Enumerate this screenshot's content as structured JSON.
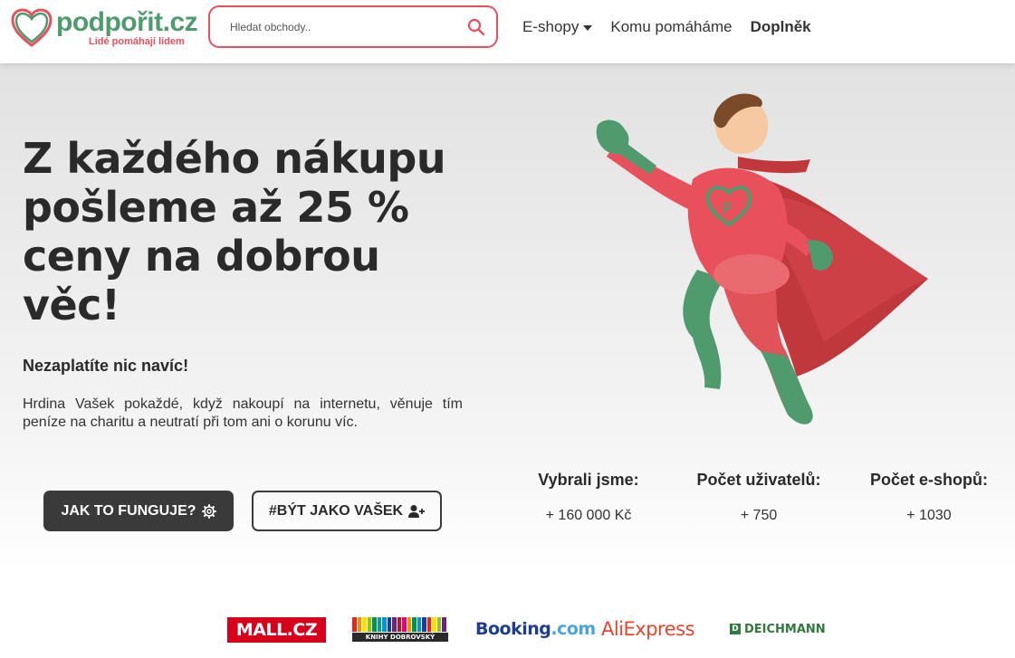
{
  "header": {
    "logo_text": "podpořit.cz",
    "logo_tagline": "Lidé pomáhají lidem",
    "search_placeholder": "Hledat obchody..",
    "nav": {
      "eshops": "E-shopy",
      "komu": "Komu pomáháme",
      "doplnek": "Doplněk"
    }
  },
  "hero": {
    "title": "Z každého nákupu pošleme až 25 % ceny na dobrou věc!",
    "subtitle": "Nezaplatíte nic navíc!",
    "description": "Hrdina Vašek pokaždé, když nakoupí na internetu, věnuje tím peníze na charitu a neutratí při tom ani o korunu víc.",
    "btn_how": "JAK TO FUNGUJE?",
    "btn_be": "#BÝT JAKO VAŠEK"
  },
  "stats": [
    {
      "label": "Vybrali jsme:",
      "value": "+ 160 000 Kč"
    },
    {
      "label": "Počet uživatelů:",
      "value": "+ 750"
    },
    {
      "label": "Počet e-shopů:",
      "value": "+ 1030"
    }
  ],
  "brands": {
    "mall": "MALL.CZ",
    "knihy": "KNIHY DOBROVSKÝ",
    "booking_main": "Booking",
    "booking_dot": ".com",
    "ali": "AliExpress",
    "deichmann": "DEICHMANN"
  },
  "colors": {
    "accent_red": "#e8505b",
    "accent_green": "#4f9b6d",
    "dark_button": "#3a3a3a"
  },
  "icons": [
    "heart-p-logo-icon",
    "search-icon",
    "caret-down-icon",
    "gear-icon",
    "user-plus-icon",
    "superhero-illustration"
  ]
}
